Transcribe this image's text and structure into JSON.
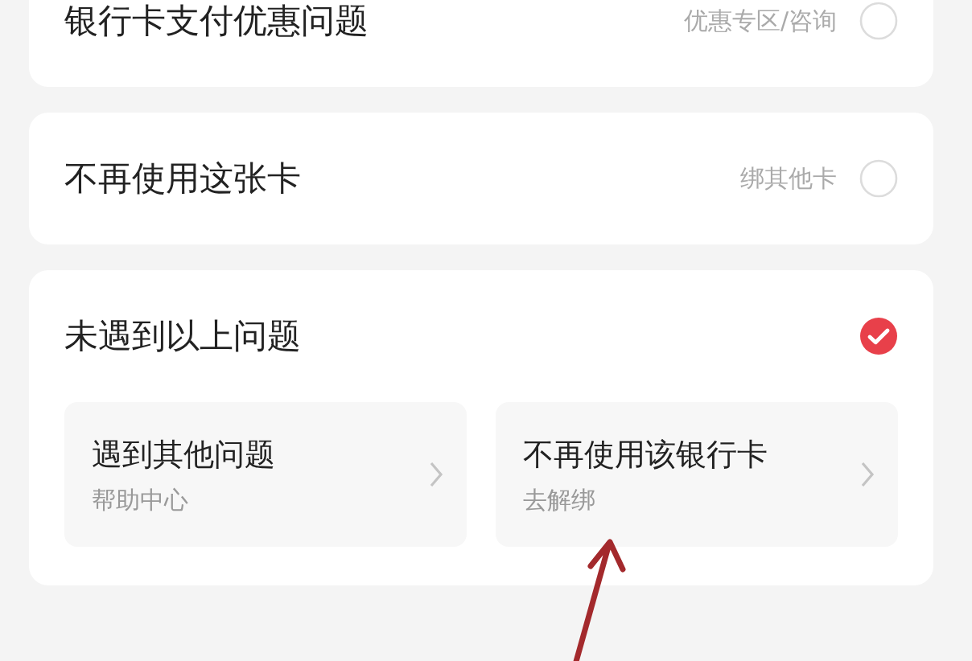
{
  "options": [
    {
      "title": "银行卡支付优惠问题",
      "hint": "优惠专区/咨询",
      "selected": false
    },
    {
      "title": "不再使用这张卡",
      "hint": "绑其他卡",
      "selected": false
    },
    {
      "title": "未遇到以上问题",
      "selected": true,
      "links": [
        {
          "title": "遇到其他问题",
          "subtitle": "帮助中心"
        },
        {
          "title": "不再使用该银行卡",
          "subtitle": "去解绑"
        }
      ]
    }
  ]
}
